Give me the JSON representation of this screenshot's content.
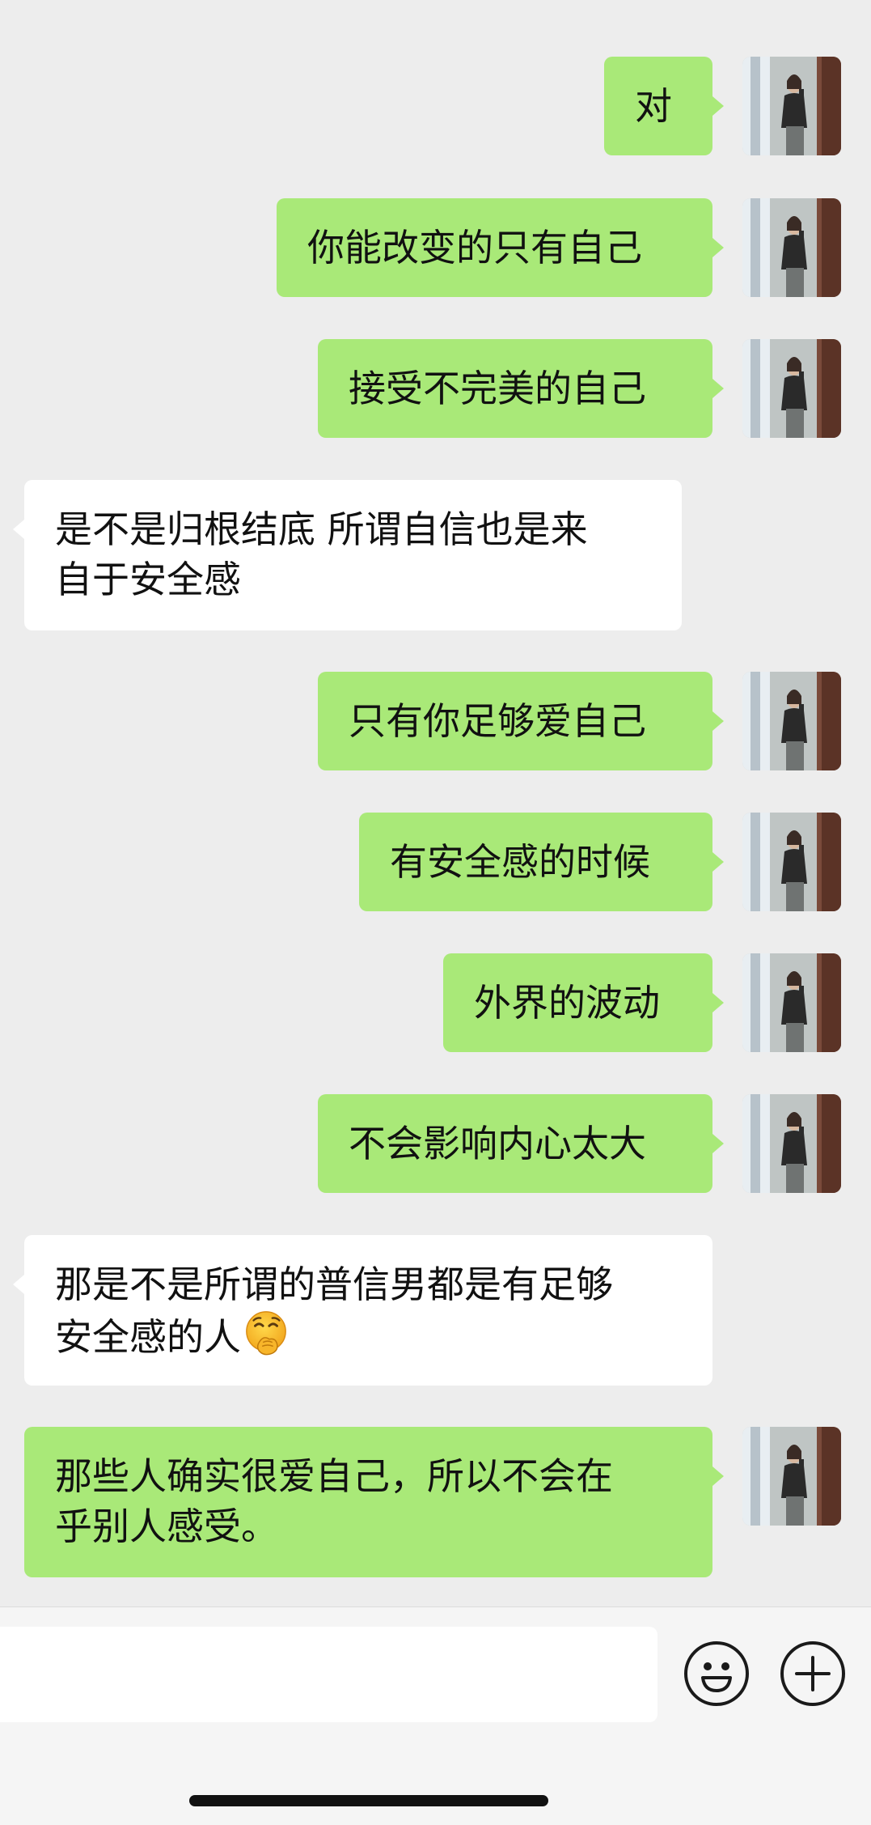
{
  "chat": {
    "messages": [
      {
        "side": "me",
        "text": "对"
      },
      {
        "side": "me",
        "text": "你能改变的只有自己"
      },
      {
        "side": "me",
        "text": "接受不完美的自己"
      },
      {
        "side": "peer",
        "lines": [
          "是不是归根结底 所谓自信也是来",
          "自于安全感"
        ]
      },
      {
        "side": "me",
        "text": "只有你足够爱自己"
      },
      {
        "side": "me",
        "text": "有安全感的时候"
      },
      {
        "side": "me",
        "text": "外界的波动"
      },
      {
        "side": "me",
        "text": "不会影响内心太大"
      },
      {
        "side": "peer",
        "lines": [
          "那是不是所谓的普信男都是有足够",
          "安全感的人"
        ],
        "emoji": "face-with-hand-over-mouth"
      },
      {
        "side": "me",
        "lines": [
          "那些人确实很爱自己，所以不会在",
          "乎别人感受。"
        ]
      }
    ],
    "avatar": "user-avatar-photo"
  },
  "input_bar": {
    "placeholder": "",
    "emoji_button_icon": "smiley-icon",
    "more_button_icon": "plus-icon"
  },
  "colors": {
    "background": "#ededed",
    "outgoing_bubble": "#a9e978",
    "incoming_bubble": "#ffffff",
    "input_bar": "#f5f5f5"
  }
}
